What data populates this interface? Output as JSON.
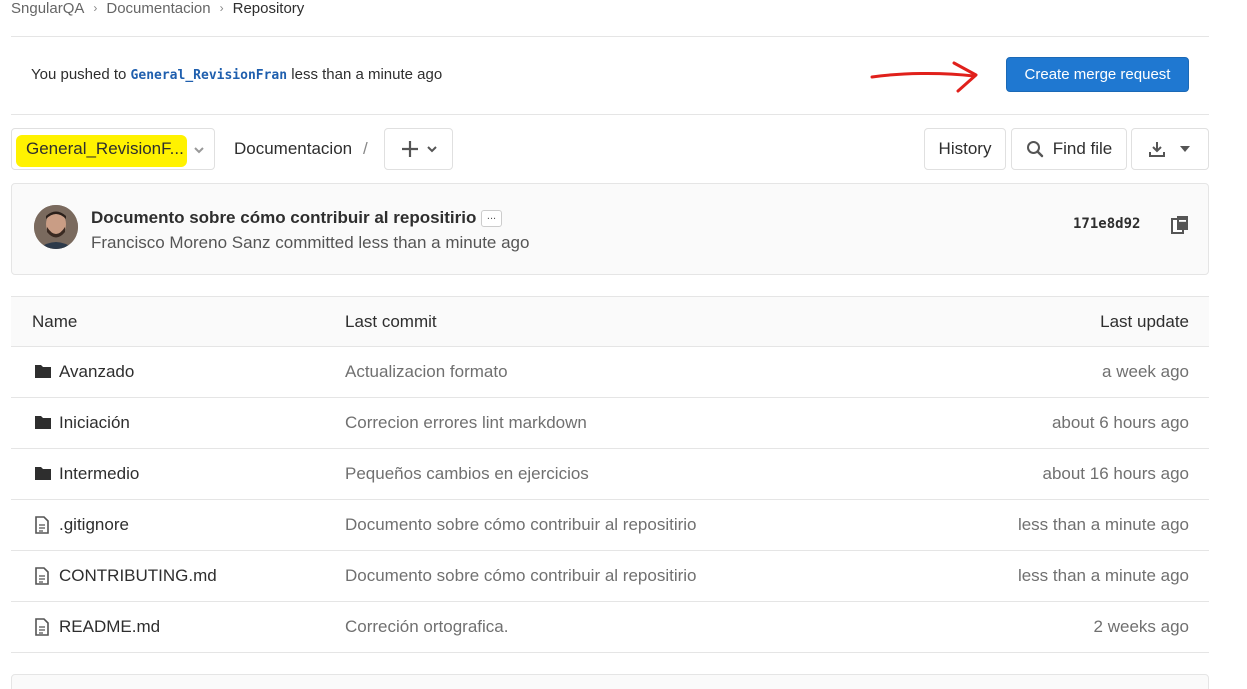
{
  "breadcrumb": {
    "items": [
      "SngularQA",
      "Documentacion"
    ],
    "current": "Repository"
  },
  "push_banner": {
    "prefix": "You pushed to",
    "branch": "General_RevisionFran",
    "suffix": "less than a minute ago",
    "button_label": "Create merge request"
  },
  "toolbar": {
    "branch": "General_RevisionF...",
    "path": "Documentacion",
    "path_separator": "/",
    "history_label": "History",
    "find_file_label": "Find file"
  },
  "last_commit": {
    "title": "Documento sobre cómo contribuir al repositirio",
    "ellipsis": "...",
    "author": "Francisco Moreno Sanz",
    "meta": "committed less than a minute ago",
    "sha": "171e8d92"
  },
  "table": {
    "headers": {
      "name": "Name",
      "last_commit": "Last commit",
      "last_update": "Last update"
    },
    "rows": [
      {
        "type": "folder",
        "name": "Avanzado",
        "commit": "Actualizacion formato",
        "updated": "a week ago"
      },
      {
        "type": "folder",
        "name": "Iniciación",
        "commit": "Correcion errores lint markdown",
        "updated": "about 6 hours ago"
      },
      {
        "type": "folder",
        "name": "Intermedio",
        "commit": "Pequeños cambios en ejercicios",
        "updated": "about 16 hours ago"
      },
      {
        "type": "file",
        "name": ".gitignore",
        "commit": "Documento sobre cómo contribuir al repositirio",
        "updated": "less than a minute ago"
      },
      {
        "type": "file",
        "name": "CONTRIBUTING.md",
        "commit": "Documento sobre cómo contribuir al repositirio",
        "updated": "less than a minute ago"
      },
      {
        "type": "file",
        "name": "README.md",
        "commit": "Correción ortografica.",
        "updated": "2 weeks ago"
      }
    ]
  },
  "colors": {
    "primary_button": "#1f78d1",
    "highlight": "#fff200",
    "annotation_arrow": "#e0201b",
    "branch_code": "#1f5fae"
  },
  "icons": {
    "folder": "folder-icon",
    "file": "file-icon",
    "search": "search-icon",
    "download": "download-icon",
    "copy": "copy-icon",
    "plus": "plus-icon",
    "caret": "chevron-down-icon"
  }
}
